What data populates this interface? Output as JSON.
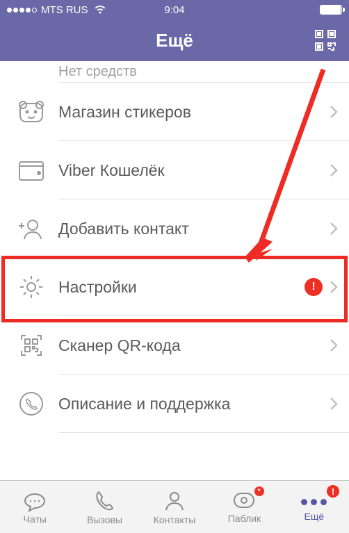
{
  "status": {
    "carrier": "MTS RUS",
    "time": "9:04"
  },
  "header": {
    "title": "Ещё"
  },
  "faded_top": "Нет средств",
  "rows": {
    "stickers": "Магазин стикеров",
    "wallet": "Viber Кошелёк",
    "add_contact": "Добавить контакт",
    "settings": "Настройки",
    "qr_scan": "Сканер QR-кода",
    "support": "Описание и поддержка"
  },
  "settings_badge": "!",
  "tabs": {
    "chats": "Чаты",
    "calls": "Вызовы",
    "contacts": "Контакты",
    "public": "Паблик",
    "more": "Ещё"
  },
  "tab_public_badge": "*",
  "tab_more_badge": "!",
  "colors": {
    "brand": "#6a68a6",
    "alert": "#ee3024"
  }
}
